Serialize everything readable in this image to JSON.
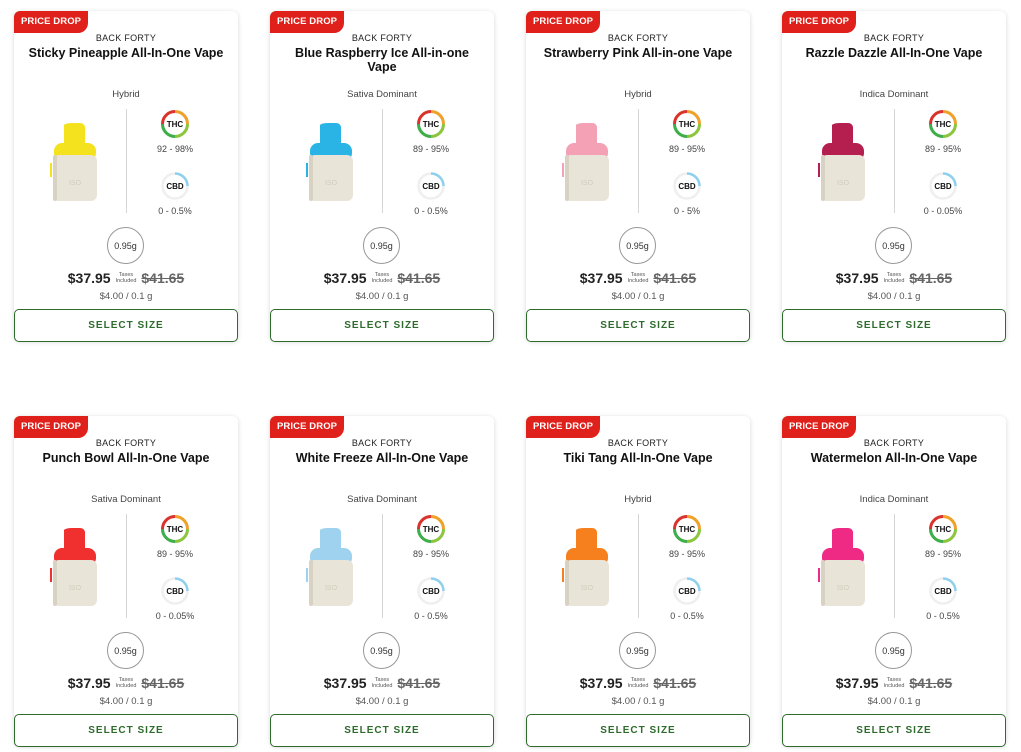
{
  "products": [
    {
      "badge": "PRICE DROP",
      "brand": "BACK FORTY",
      "name": "Sticky Pineapple All-In-One Vape",
      "type": "Hybrid",
      "thc_label": "THC",
      "thc": "92 - 98%",
      "cbd_label": "CBD",
      "cbd": "0 - 0.5%",
      "weight": "0.95g",
      "price": "$37.95",
      "taxes_note": "Taxes Included",
      "old_price": "$41.65",
      "unit_price": "$4.00 / 0.1 g",
      "button": "SELECT SIZE",
      "tip_color": "#f5e21f"
    },
    {
      "badge": "PRICE DROP",
      "brand": "BACK FORTY",
      "name": "Blue Raspberry Ice All-in-one Vape",
      "type": "Sativa Dominant",
      "thc_label": "THC",
      "thc": "89 - 95%",
      "cbd_label": "CBD",
      "cbd": "0 - 0.5%",
      "weight": "0.95g",
      "price": "$37.95",
      "taxes_note": "Taxes Included",
      "old_price": "$41.65",
      "unit_price": "$4.00 / 0.1 g",
      "button": "SELECT SIZE",
      "tip_color": "#2ab4e6"
    },
    {
      "badge": "PRICE DROP",
      "brand": "BACK FORTY",
      "name": "Strawberry Pink All-in-one Vape",
      "type": "Hybrid",
      "thc_label": "THC",
      "thc": "89 - 95%",
      "cbd_label": "CBD",
      "cbd": "0 - 5%",
      "weight": "0.95g",
      "price": "$37.95",
      "taxes_note": "Taxes Included",
      "old_price": "$41.65",
      "unit_price": "$4.00 / 0.1 g",
      "button": "SELECT SIZE",
      "tip_color": "#f4a1b6"
    },
    {
      "badge": "PRICE DROP",
      "brand": "BACK FORTY",
      "name": "Razzle Dazzle All-In-One Vape",
      "type": "Indica Dominant",
      "thc_label": "THC",
      "thc": "89 - 95%",
      "cbd_label": "CBD",
      "cbd": "0 - 0.05%",
      "weight": "0.95g",
      "price": "$37.95",
      "taxes_note": "Taxes Included",
      "old_price": "$41.65",
      "unit_price": "$4.00 / 0.1 g",
      "button": "SELECT SIZE",
      "tip_color": "#b51f4f"
    },
    {
      "badge": "PRICE DROP",
      "brand": "BACK FORTY",
      "name": "Punch Bowl All-In-One Vape",
      "type": "Sativa Dominant",
      "thc_label": "THC",
      "thc": "89 - 95%",
      "cbd_label": "CBD",
      "cbd": "0 - 0.05%",
      "weight": "0.95g",
      "price": "$37.95",
      "taxes_note": "Taxes Included",
      "old_price": "$41.65",
      "unit_price": "$4.00 / 0.1 g",
      "button": "SELECT SIZE",
      "tip_color": "#f0302e"
    },
    {
      "badge": "PRICE DROP",
      "brand": "BACK FORTY",
      "name": "White Freeze All-In-One Vape",
      "type": "Sativa Dominant",
      "thc_label": "THC",
      "thc": "89 - 95%",
      "cbd_label": "CBD",
      "cbd": "0 - 0.5%",
      "weight": "0.95g",
      "price": "$37.95",
      "taxes_note": "Taxes Included",
      "old_price": "$41.65",
      "unit_price": "$4.00 / 0.1 g",
      "button": "SELECT SIZE",
      "tip_color": "#9ed2ee"
    },
    {
      "badge": "PRICE DROP",
      "brand": "BACK FORTY",
      "name": "Tiki Tang All-In-One Vape",
      "type": "Hybrid",
      "thc_label": "THC",
      "thc": "89 - 95%",
      "cbd_label": "CBD",
      "cbd": "0 - 0.5%",
      "weight": "0.95g",
      "price": "$37.95",
      "taxes_note": "Taxes Included",
      "old_price": "$41.65",
      "unit_price": "$4.00 / 0.1 g",
      "button": "SELECT SIZE",
      "tip_color": "#f6801d"
    },
    {
      "badge": "PRICE DROP",
      "brand": "BACK FORTY",
      "name": "Watermelon All-In-One Vape",
      "type": "Indica Dominant",
      "thc_label": "THC",
      "thc": "89 - 95%",
      "cbd_label": "CBD",
      "cbd": "0 - 0.5%",
      "weight": "0.95g",
      "price": "$37.95",
      "taxes_note": "Taxes Included",
      "old_price": "$41.65",
      "unit_price": "$4.00 / 0.1 g",
      "button": "SELECT SIZE",
      "tip_color": "#ee2a85"
    }
  ],
  "colors": {
    "badge": "#e0201b",
    "button": "#2e6b2c",
    "cbd_ring": "#8fd0ee"
  }
}
